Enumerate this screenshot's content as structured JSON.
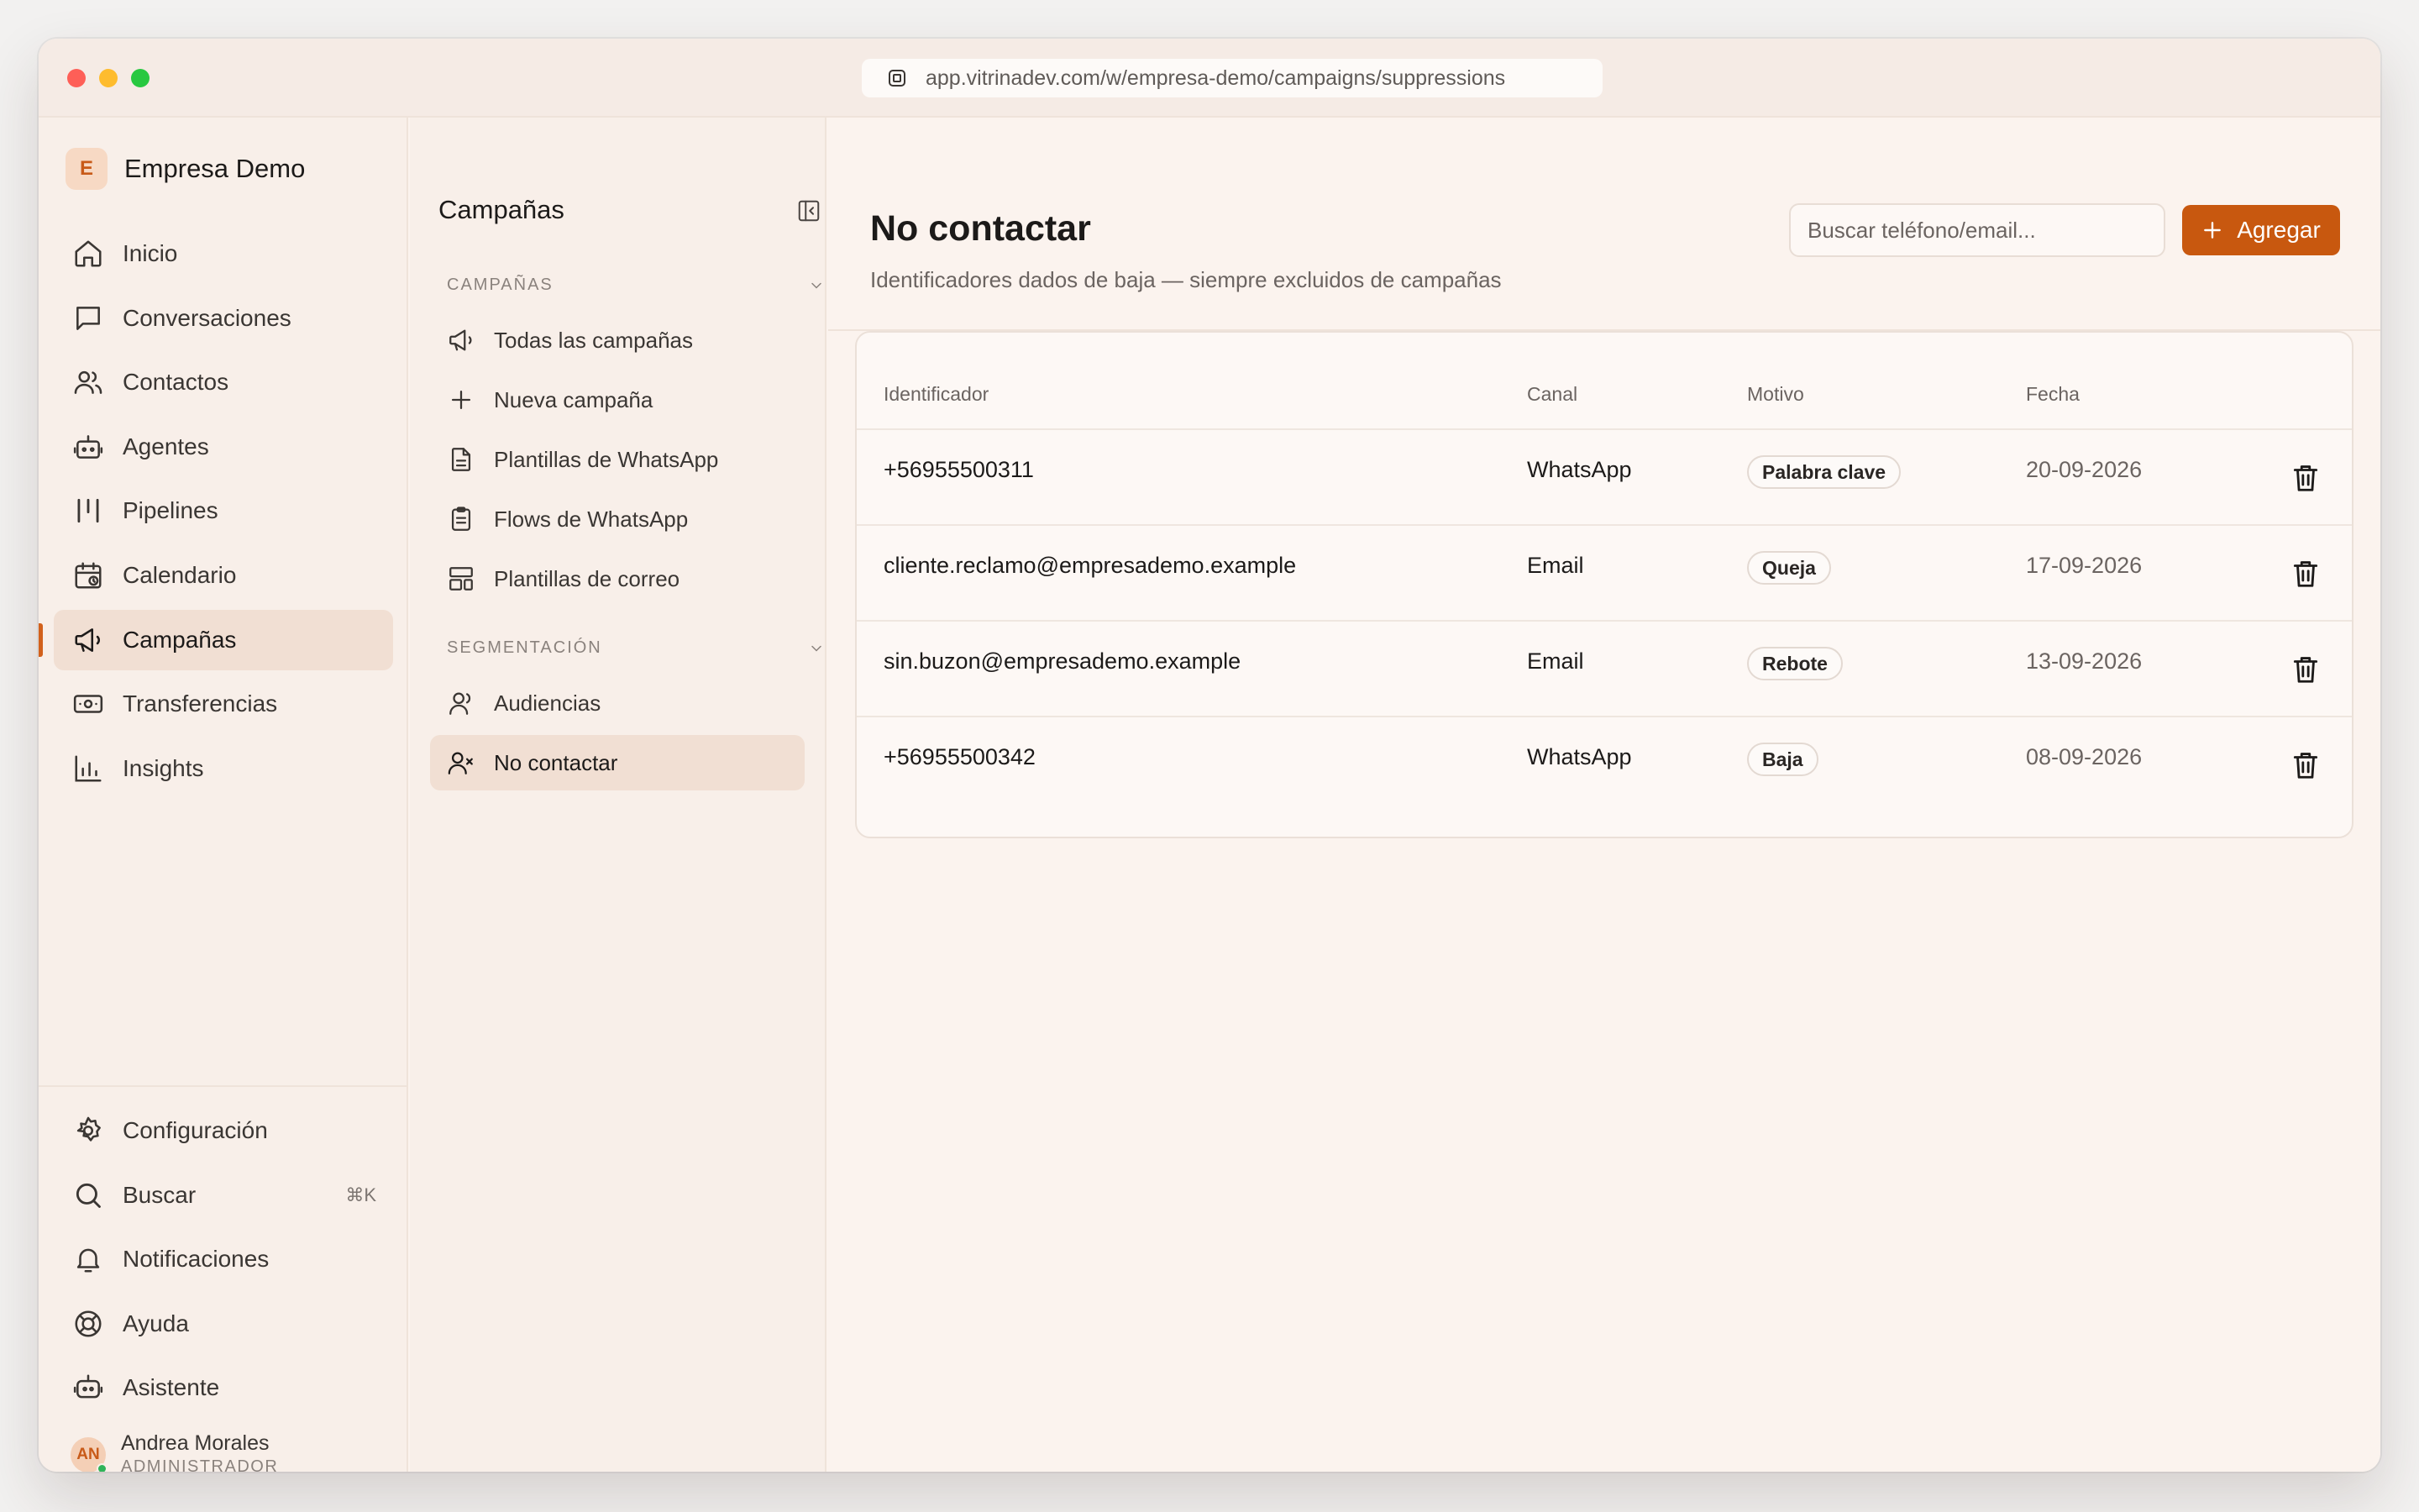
{
  "browser": {
    "url": "app.vitrinadev.com/w/empresa-demo/campaigns/suppressions"
  },
  "workspace": {
    "initial": "E",
    "name": "Empresa Demo"
  },
  "sidebar": {
    "items": [
      {
        "label": "Inicio",
        "icon": "home-icon"
      },
      {
        "label": "Conversaciones",
        "icon": "chat-icon"
      },
      {
        "label": "Contactos",
        "icon": "users-icon"
      },
      {
        "label": "Agentes",
        "icon": "bot-icon"
      },
      {
        "label": "Pipelines",
        "icon": "pipeline-icon"
      },
      {
        "label": "Calendario",
        "icon": "calendar-icon"
      },
      {
        "label": "Campañas",
        "icon": "megaphone-icon",
        "active": true
      },
      {
        "label": "Transferencias",
        "icon": "banknote-icon"
      },
      {
        "label": "Insights",
        "icon": "bar-chart-icon"
      }
    ],
    "bottom_items": [
      {
        "label": "Configuración",
        "icon": "gear-icon"
      },
      {
        "label": "Buscar",
        "icon": "search-icon",
        "shortcut": "⌘K"
      },
      {
        "label": "Notificaciones",
        "icon": "bell-icon"
      },
      {
        "label": "Ayuda",
        "icon": "lifebuoy-icon"
      },
      {
        "label": "Asistente",
        "icon": "assistant-icon"
      }
    ],
    "user": {
      "initials": "AN",
      "name": "Andrea Morales",
      "role": "ADMINISTRADOR"
    }
  },
  "subnav": {
    "title": "Campañas",
    "sections": [
      {
        "label": "CAMPAÑAS",
        "items": [
          {
            "label": "Todas las campañas",
            "icon": "megaphone-icon"
          },
          {
            "label": "Nueva campaña",
            "icon": "plus-icon"
          },
          {
            "label": "Plantillas de WhatsApp",
            "icon": "file-text-icon"
          },
          {
            "label": "Flows de WhatsApp",
            "icon": "clipboard-icon"
          },
          {
            "label": "Plantillas de correo",
            "icon": "layout-template-icon"
          }
        ]
      },
      {
        "label": "SEGMENTACIÓN",
        "items": [
          {
            "label": "Audiencias",
            "icon": "audience-icon"
          },
          {
            "label": "No contactar",
            "icon": "user-x-icon",
            "active": true
          }
        ]
      }
    ]
  },
  "main": {
    "title": "No contactar",
    "subtitle": "Identificadores dados de baja — siempre excluidos de campañas",
    "search_placeholder": "Buscar teléfono/email...",
    "add_label": "Agregar",
    "columns": [
      "Identificador",
      "Canal",
      "Motivo",
      "Fecha"
    ],
    "rows": [
      {
        "identifier": "+56955500311",
        "channel": "WhatsApp",
        "reason": "Palabra clave",
        "date": "20-09-2026"
      },
      {
        "identifier": "cliente.reclamo@empresademo.example",
        "channel": "Email",
        "reason": "Queja",
        "date": "17-09-2026"
      },
      {
        "identifier": "sin.buzon@empresademo.example",
        "channel": "Email",
        "reason": "Rebote",
        "date": "13-09-2026"
      },
      {
        "identifier": "+56955500342",
        "channel": "WhatsApp",
        "reason": "Baja",
        "date": "08-09-2026"
      }
    ]
  },
  "colors": {
    "accent": "#c8580f",
    "active_bg": "#f1dfd3",
    "background": "#fbf3ee"
  }
}
